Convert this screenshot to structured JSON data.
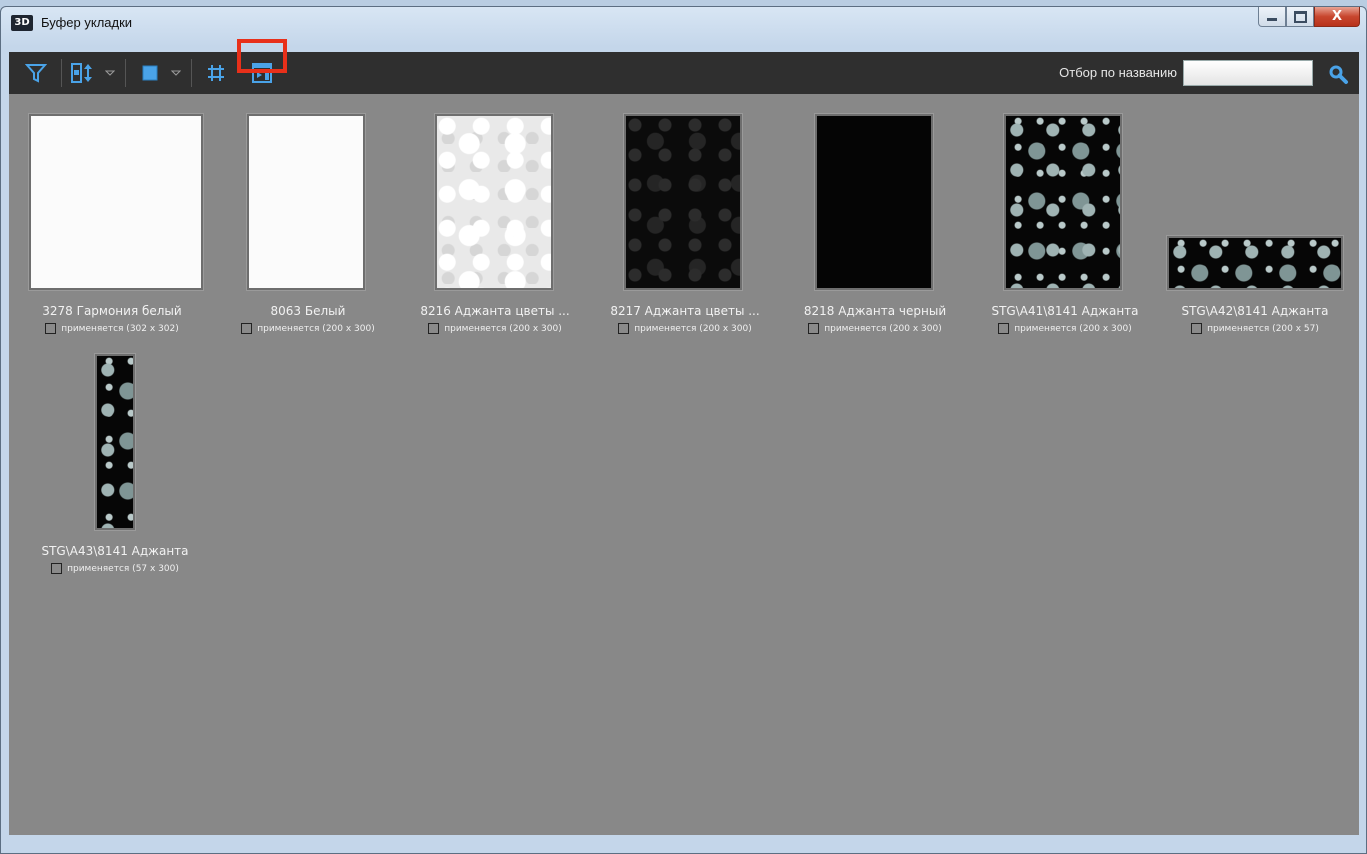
{
  "window": {
    "title": "Буфер укладки",
    "app_icon_text": "3D",
    "close_glyph": "X"
  },
  "toolbar": {
    "filter_label": "Отбор по названию",
    "filter_value": "",
    "icons": [
      "filter-icon",
      "sort-icon",
      "dropdown-arrow-icon",
      "view-square-icon",
      "dropdown-arrow-icon",
      "grid-icon",
      "apply-panel-icon",
      "search-icon"
    ],
    "accent_color": "#4aa3e8",
    "highlight_color": "#e8301a"
  },
  "tiles": [
    {
      "name": "3278 Гармония белый",
      "status": "применяется (302 x 302)",
      "texture": "white"
    },
    {
      "name": "8063 Белый",
      "status": "применяется (200 x 300)",
      "texture": "white"
    },
    {
      "name": "8216 Аджанта цветы ...",
      "status": "применяется (200 x 300)",
      "texture": "relief-white"
    },
    {
      "name": "8217 Аджанта цветы ...",
      "status": "применяется (200 x 300)",
      "texture": "dark-floral"
    },
    {
      "name": "8218 Аджанта черный",
      "status": "применяется (200 x 300)",
      "texture": "black"
    },
    {
      "name": "STG\\A41\\8141 Аджанта",
      "status": "применяется (200 x 300)",
      "texture": "floral-grey"
    },
    {
      "name": "STG\\A42\\8141 Аджанта",
      "status": "применяется (200 x 57)",
      "texture": "floral-grey"
    },
    {
      "name": "STG\\A43\\8141 Аджанта",
      "status": "применяется (57 x 300)",
      "texture": "floral-grey"
    }
  ]
}
